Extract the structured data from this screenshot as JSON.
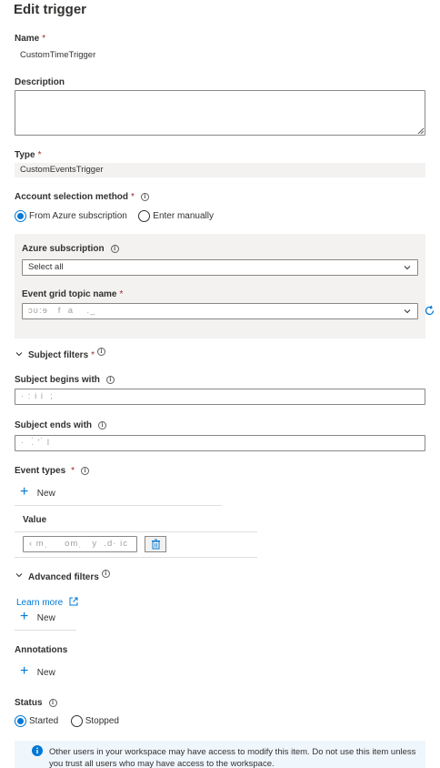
{
  "title": "Edit trigger",
  "required_mark": "*",
  "name": {
    "label": "Name",
    "value": "CustomTimeTrigger"
  },
  "description": {
    "label": "Description",
    "value": ""
  },
  "type": {
    "label": "Type",
    "value": "CustomEventsTrigger"
  },
  "account_selection": {
    "label": "Account selection method",
    "options": [
      "From Azure subscription",
      "Enter manually"
    ],
    "selected": "From Azure subscription"
  },
  "azure_subscription": {
    "label": "Azure subscription",
    "value": "Select all"
  },
  "event_grid_topic": {
    "label": "Event grid topic name",
    "value": "ɔʋ:ɘ   f  a    ._"
  },
  "subject_filters": {
    "label": "Subject filters"
  },
  "subject_begins": {
    "label": "Subject begins with",
    "value": "· : i i  ;"
  },
  "subject_ends": {
    "label": "Subject ends with",
    "value": "·  .̀ ' ̀ l"
  },
  "event_types": {
    "label": "Event types",
    "new_label": "New",
    "column_header": "Value",
    "rows": [
      "‹ mˌ     omˌ   y  .d· ic"
    ]
  },
  "advanced_filters": {
    "label": "Advanced filters",
    "learn_more": "Learn more",
    "new_label": "New"
  },
  "annotations": {
    "label": "Annotations",
    "new_label": "New"
  },
  "status": {
    "label": "Status",
    "options": [
      "Started",
      "Stopped"
    ],
    "selected": "Started"
  },
  "banner": {
    "text": "Other users in your workspace may have access to modify this item. Do not use this item unless you trust all users who may have access to the workspace."
  },
  "colors": {
    "accent": "#0078d4",
    "required": "#a4262c",
    "panel": "#f3f2f1",
    "banner": "#eff6fc"
  }
}
